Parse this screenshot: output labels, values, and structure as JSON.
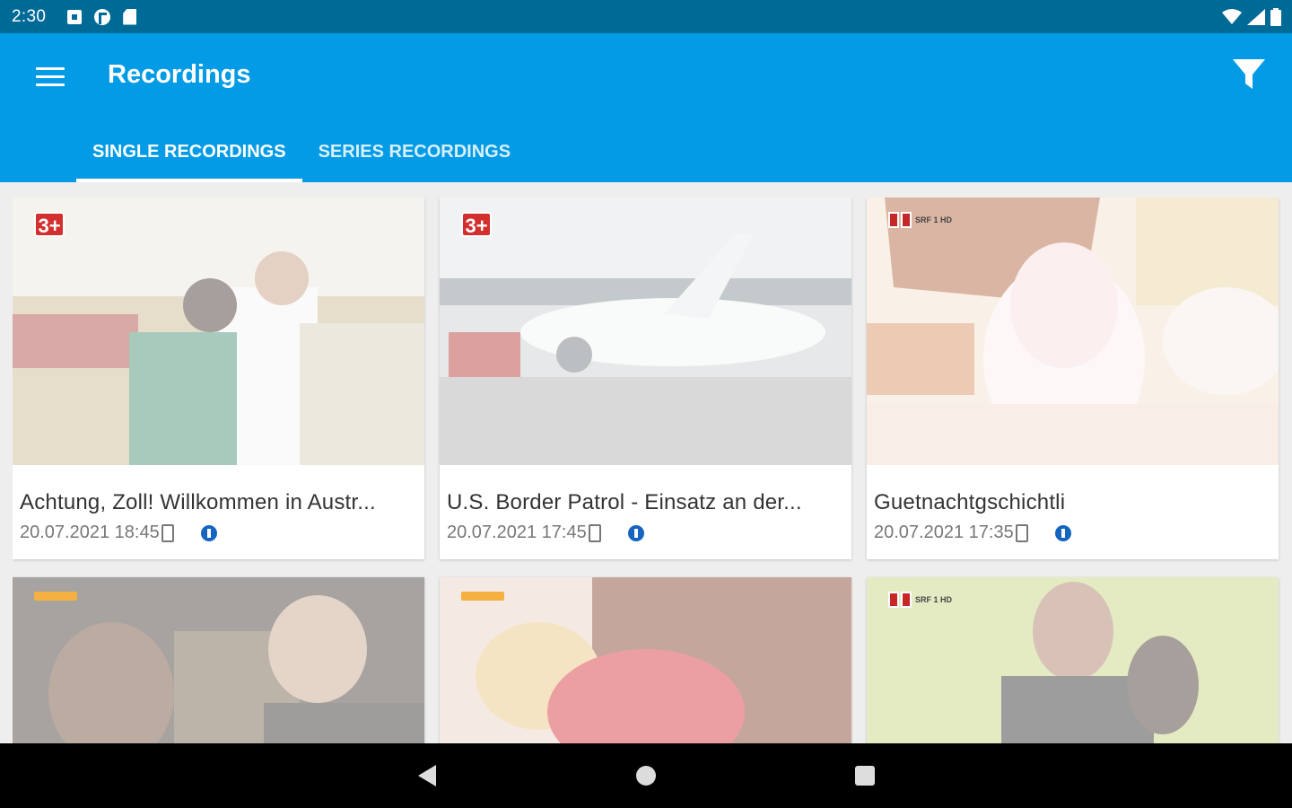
{
  "status_bar": {
    "time": "2:30",
    "icons": [
      "notification-square-icon",
      "vpn-icon",
      "sd-card-icon",
      "wifi-icon",
      "signal-icon",
      "battery-icon"
    ]
  },
  "app_bar": {
    "title": "Recordings",
    "menu_icon": "hamburger-menu-icon",
    "filter_icon": "filter-icon",
    "tabs": [
      {
        "label": "SINGLE RECORDINGS",
        "active": true
      },
      {
        "label": "SERIES RECORDINGS",
        "active": false
      }
    ]
  },
  "recordings": [
    {
      "title": "Achtung, Zoll! Willkommen in Austr...",
      "datetime": "20.07.2021 18:45",
      "channel": "3+"
    },
    {
      "title": "U.S. Border Patrol - Einsatz an der...",
      "datetime": "20.07.2021 17:45",
      "channel": "3+"
    },
    {
      "title": "Guetnachtgschichtli",
      "datetime": "20.07.2021 17:35",
      "channel": "SRF 1 HD"
    },
    {
      "title": "",
      "datetime": "",
      "channel": "orange-logo"
    },
    {
      "title": "",
      "datetime": "",
      "channel": "orange-logo"
    },
    {
      "title": "",
      "datetime": "",
      "channel": "SRF 1 HD"
    }
  ],
  "colors": {
    "status_bar": "#006a96",
    "app_bar": "#039be5",
    "info_icon": "#1565c0",
    "channel_red": "#d32f2f"
  },
  "nav_bar": {
    "icons": [
      "back-icon",
      "home-icon",
      "recents-icon"
    ]
  }
}
